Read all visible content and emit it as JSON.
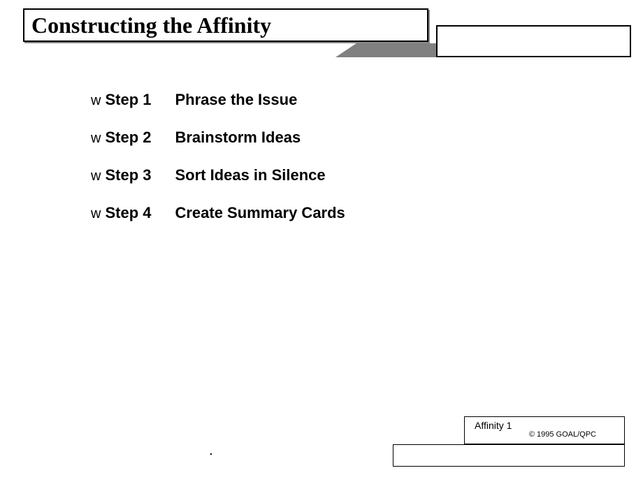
{
  "title": "Constructing the Affinity",
  "steps": [
    {
      "bullet": "w",
      "label": "Step 1",
      "text": "Phrase the Issue"
    },
    {
      "bullet": "w",
      "label": "Step 2",
      "text": "Brainstorm Ideas"
    },
    {
      "bullet": "w",
      "label": "Step 3",
      "text": "Sort Ideas in Silence"
    },
    {
      "bullet": "w",
      "label": "Step 4",
      "text": "Create Summary Cards"
    }
  ],
  "stray": ".",
  "footer": {
    "page": "Affinity 1",
    "copyright": "© 1995 GOAL/QPC"
  }
}
